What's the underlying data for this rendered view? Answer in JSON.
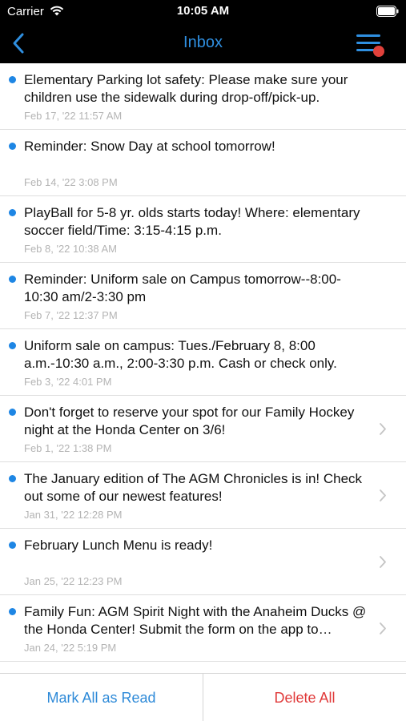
{
  "status_bar": {
    "carrier": "Carrier",
    "time": "10:05 AM"
  },
  "nav": {
    "title": "Inbox",
    "back_icon": "chevron-left-icon",
    "menu_icon": "hamburger-menu-icon",
    "accent_color": "#2f8fe0",
    "badge_color": "#e0413b"
  },
  "messages": [
    {
      "text": "Elementary Parking lot safety: Please make sure your children use the sidewalk during drop-off/pick-up.",
      "date": "Feb 17, '22 11:57 AM",
      "unread": true,
      "has_chevron": false
    },
    {
      "text": "Reminder: Snow Day at school tomorrow!",
      "date": "Feb 14, '22 3:08 PM",
      "unread": true,
      "has_chevron": false
    },
    {
      "text": "PlayBall for 5-8 yr. olds starts today! Where: elementary soccer field/Time: 3:15-4:15 p.m.",
      "date": "Feb 8, '22 10:38 AM",
      "unread": true,
      "has_chevron": false
    },
    {
      "text": "Reminder: Uniform sale on Campus tomorrow--8:00-10:30 am/2-3:30 pm",
      "date": "Feb 7, '22 12:37 PM",
      "unread": true,
      "has_chevron": false
    },
    {
      "text": "Uniform sale on campus: Tues./February 8, 8:00 a.m.-10:30 a.m., 2:00-3:30 p.m. Cash or check only.",
      "date": "Feb 3, '22 4:01 PM",
      "unread": true,
      "has_chevron": false
    },
    {
      "text": "Don't forget to reserve your spot for our Family Hockey night at the Honda Center on 3/6!",
      "date": "Feb 1, '22 1:38 PM",
      "unread": true,
      "has_chevron": true
    },
    {
      "text": "The January edition of The AGM Chronicles is in! Check out some of our newest features!",
      "date": "Jan 31, '22 12:28 PM",
      "unread": true,
      "has_chevron": true
    },
    {
      "text": "February Lunch Menu is ready!",
      "date": "Jan 25, '22 12:23 PM",
      "unread": true,
      "has_chevron": true
    },
    {
      "text": "Family Fun: AGM Spirit Night with the Anaheim Ducks @ the Honda Center! Submit the form on the app to…",
      "date": "Jan 24, '22 5:19 PM",
      "unread": true,
      "has_chevron": true
    }
  ],
  "actions": {
    "mark_all_read": "Mark All as Read",
    "delete_all": "Delete All"
  }
}
